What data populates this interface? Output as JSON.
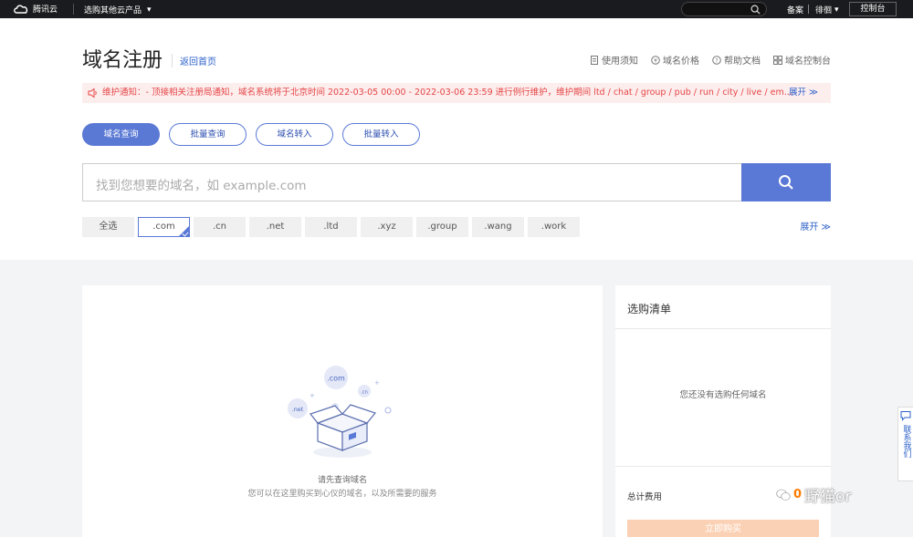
{
  "topbar": {
    "brand": "腾讯云",
    "products": "选购其他云产品",
    "beian": "备案",
    "user": "徘徊",
    "console": "控制台"
  },
  "header": {
    "title": "域名注册",
    "back_home": "返回首页",
    "links": [
      "使用须知",
      "域名价格",
      "帮助文档",
      "域名控制台"
    ]
  },
  "notice": {
    "text": "维护通知：- 顶接相关注册局通知，域名系统将于北京时间 2022-03-05 00:00 - 2022-03-06 23:59 进行例行维护，维护期间 ltd / chat / group / pub / run / city / live / em...",
    "expand": "展开 ≫"
  },
  "tabs": [
    {
      "label": "域名查询",
      "active": true
    },
    {
      "label": "批量查询",
      "active": false
    },
    {
      "label": "域名转入",
      "active": false
    },
    {
      "label": "批量转入",
      "active": false
    }
  ],
  "search": {
    "placeholder": "找到您想要的域名，如 example.com"
  },
  "suffixes": [
    {
      "label": "全选",
      "selected": false
    },
    {
      "label": ".com",
      "selected": true
    },
    {
      "label": ".cn",
      "selected": false
    },
    {
      "label": ".net",
      "selected": false
    },
    {
      "label": ".ltd",
      "selected": false
    },
    {
      "label": ".xyz",
      "selected": false
    },
    {
      "label": ".group",
      "selected": false
    },
    {
      "label": ".wang",
      "selected": false
    },
    {
      "label": ".work",
      "selected": false
    }
  ],
  "expand_more": "展开 ≫",
  "results": {
    "empty_title": "请先查询域名",
    "empty_sub": "您可以在这里购买到心仪的域名，以及所需要的服务",
    "bubble_com": ".com",
    "bubble_net": ".net",
    "bubble_cn": ".cn"
  },
  "cart": {
    "title": "选购清单",
    "empty": "您还没有选购任何域名",
    "total_label": "总计费用",
    "buy": "立即购买"
  },
  "side_float": "联系我们",
  "watermark": {
    "num": "0",
    "text": "野猫or"
  },
  "colors": {
    "accent": "#5a78d6",
    "notice_bg": "#fdeeee",
    "notice_text": "#e54545",
    "topbar": "#1a1b1e"
  }
}
